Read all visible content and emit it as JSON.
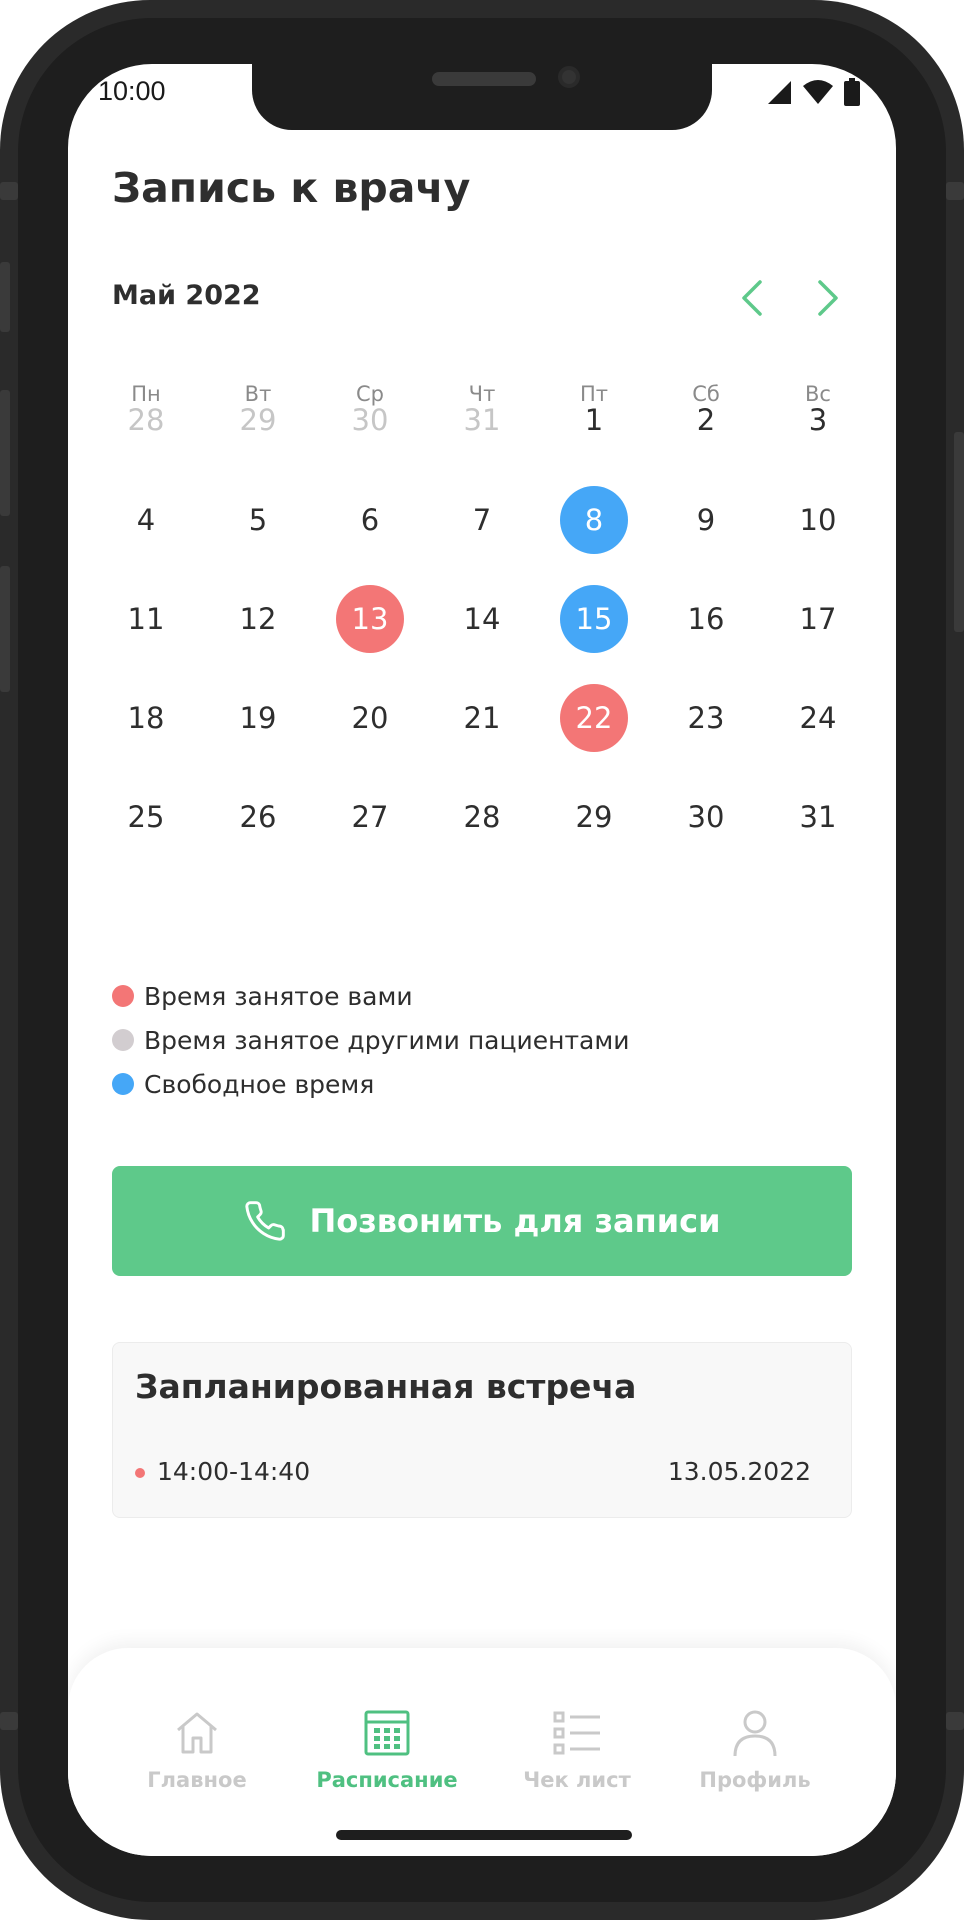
{
  "status_bar": {
    "time": "10:00"
  },
  "header": {
    "title": "Запись к врачу"
  },
  "calendar": {
    "month_label": "Май 2022",
    "prev_icon": "chevron-left-icon",
    "next_icon": "chevron-right-icon",
    "weekdays": [
      "Пн",
      "Вт",
      "Ср",
      "Чт",
      "Пт",
      "Сб",
      "Вс"
    ],
    "weeks": [
      [
        "28",
        "29",
        "30",
        "31",
        "1",
        "2",
        "3"
      ],
      [
        "4",
        "5",
        "6",
        "7",
        "8",
        "9",
        "10"
      ],
      [
        "11",
        "12",
        "13",
        "14",
        "15",
        "16",
        "17"
      ],
      [
        "18",
        "19",
        "20",
        "21",
        "22",
        "23",
        "24"
      ],
      [
        "25",
        "26",
        "27",
        "28",
        "29",
        "30",
        "31"
      ]
    ],
    "outside_month_days": [
      "28",
      "29",
      "30",
      "31"
    ],
    "booked_by_you": [
      "13",
      "22"
    ],
    "free_time": [
      "8",
      "15"
    ]
  },
  "legend": [
    {
      "label": "Время занятое вами",
      "color": "#f37676"
    },
    {
      "label": "Время занятое другими пациентами",
      "color": "#d2cdd0"
    },
    {
      "label": "Свободное время",
      "color": "#45a7f7"
    }
  ],
  "call_button": {
    "label": "Позвонить для записи",
    "icon": "phone-icon",
    "color": "#5ec98a"
  },
  "appointment": {
    "title": "Запланированная встреча",
    "time": "14:00-14:40",
    "date": "13.05.2022",
    "dot_color": "#f37676"
  },
  "tab_bar": {
    "active_color": "#4fc081",
    "inactive_color": "#c9c9c9",
    "tabs": [
      {
        "label": "Главное",
        "icon": "home-icon",
        "active": false
      },
      {
        "label": "Расписание",
        "icon": "calendar-icon",
        "active": true
      },
      {
        "label": "Чек лист",
        "icon": "checklist-icon",
        "active": false
      },
      {
        "label": "Профиль",
        "icon": "profile-icon",
        "active": false
      }
    ]
  }
}
